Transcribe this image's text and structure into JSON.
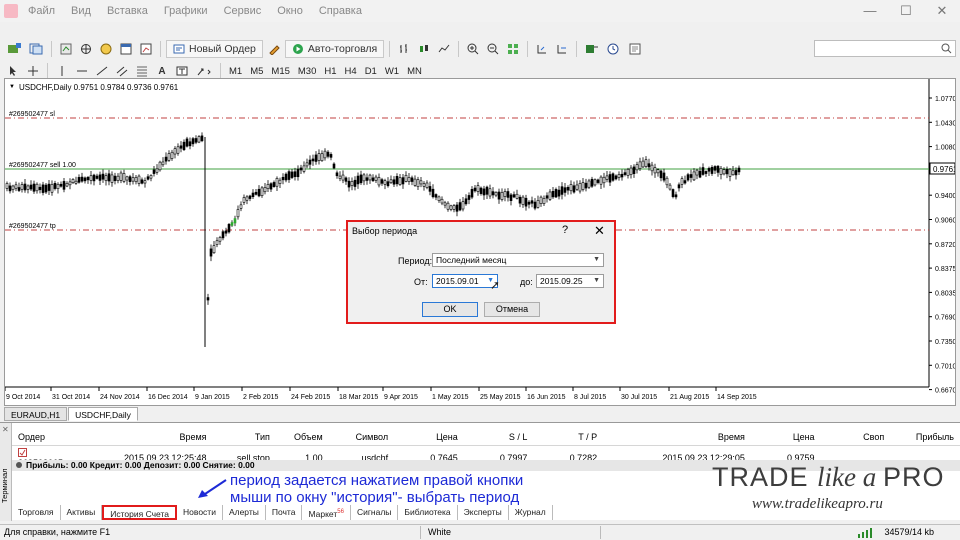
{
  "menu": [
    "Файл",
    "Вид",
    "Вставка",
    "Графики",
    "Сервис",
    "Окно",
    "Справка"
  ],
  "window_controls": {
    "minimize": "—",
    "maximize": "☐",
    "close": "✕"
  },
  "toolbar": {
    "new_order": "Новый Ордер",
    "auto_trading": "Авто-торговля",
    "timeframes": [
      "M1",
      "M5",
      "M15",
      "M30",
      "H1",
      "H4",
      "D1",
      "W1",
      "MN"
    ]
  },
  "chart": {
    "title": "USDCHF,Daily  0.9751 0.9784 0.9736 0.9761",
    "sl_label": "#269502477 sl",
    "sell_label": "#269502477 sell 1.00",
    "tp_label": "#269502477 tp",
    "current_price": "0.9761",
    "price_axis": [
      "1.0770",
      "1.0430",
      "1.0080",
      "0.9761",
      "0.9400",
      "0.9060",
      "0.8720",
      "0.8375",
      "0.8035",
      "0.7690",
      "0.7350",
      "0.7010",
      "0.6670"
    ],
    "date_axis": [
      "9 Oct 2014",
      "31 Oct 2014",
      "24 Nov 2014",
      "16 Dec 2014",
      "9 Jan 2015",
      "2 Feb 2015",
      "24 Feb 2015",
      "18 Mar 2015",
      "9 Apr 2015",
      "1 May 2015",
      "25 May 2015",
      "16 Jun 2015",
      "8 Jul 2015",
      "30 Jul 2015",
      "21 Aug 2015",
      "14 Sep 2015"
    ],
    "colors": {
      "candle": "#000000",
      "sl_tp_line": "#c04040",
      "entry_line": "#40a040",
      "bullish_highlight": "#2faa2f"
    }
  },
  "chart_tabs": [
    "EURAUD,H1",
    "USDCHF,Daily"
  ],
  "orders": {
    "headers": [
      "Ордер",
      "",
      "Время",
      "Тип",
      "Объем",
      "Символ",
      "Цена",
      "S / L",
      "T / P",
      "Время",
      "Цена",
      "Своп",
      "Прибыль"
    ],
    "rows": [
      [
        "269503065",
        "",
        "2015.09.23 12:25:48",
        "sell stop",
        "1.00",
        "usdchf",
        "0.7645",
        "0.7997",
        "0.7282",
        "2015.09.23 12:29:05",
        "0.9759",
        "",
        ""
      ]
    ],
    "summary": "Прибыль: 0.00  Кредит: 0.00  Депозит: 0.00  Снятие: 0.00"
  },
  "terminal_label": "Терминал",
  "terminal_tabs": [
    "Торговля",
    "Активы",
    "История Счета",
    "Новости",
    "Алерты",
    "Почта",
    "Маркет",
    "Сигналы",
    "Библиотека",
    "Эксперты",
    "Журнал"
  ],
  "market_badge": "56",
  "dialog": {
    "title": "Выбор периода",
    "help": "?",
    "close": "✕",
    "period_label": "Период:",
    "period_value": "Последний месяц",
    "from_label": "От:",
    "from_value": "2015.09.01",
    "to_label": "до:",
    "to_value": "2015.09.25",
    "ok": "OK",
    "cancel": "Отмена"
  },
  "status": {
    "help": "Для справки, нажмите F1",
    "profile": "White",
    "traffic": "34579/14 kb"
  },
  "annotation": {
    "line1": "период задается нажатием правой кнопки",
    "line2": "мыши по окну \"история\"- выбрать период"
  },
  "logo": {
    "part1": "TRADE ",
    "part2": "like a ",
    "part3": "PRO",
    "url": "www.tradelikeapro.ru"
  }
}
